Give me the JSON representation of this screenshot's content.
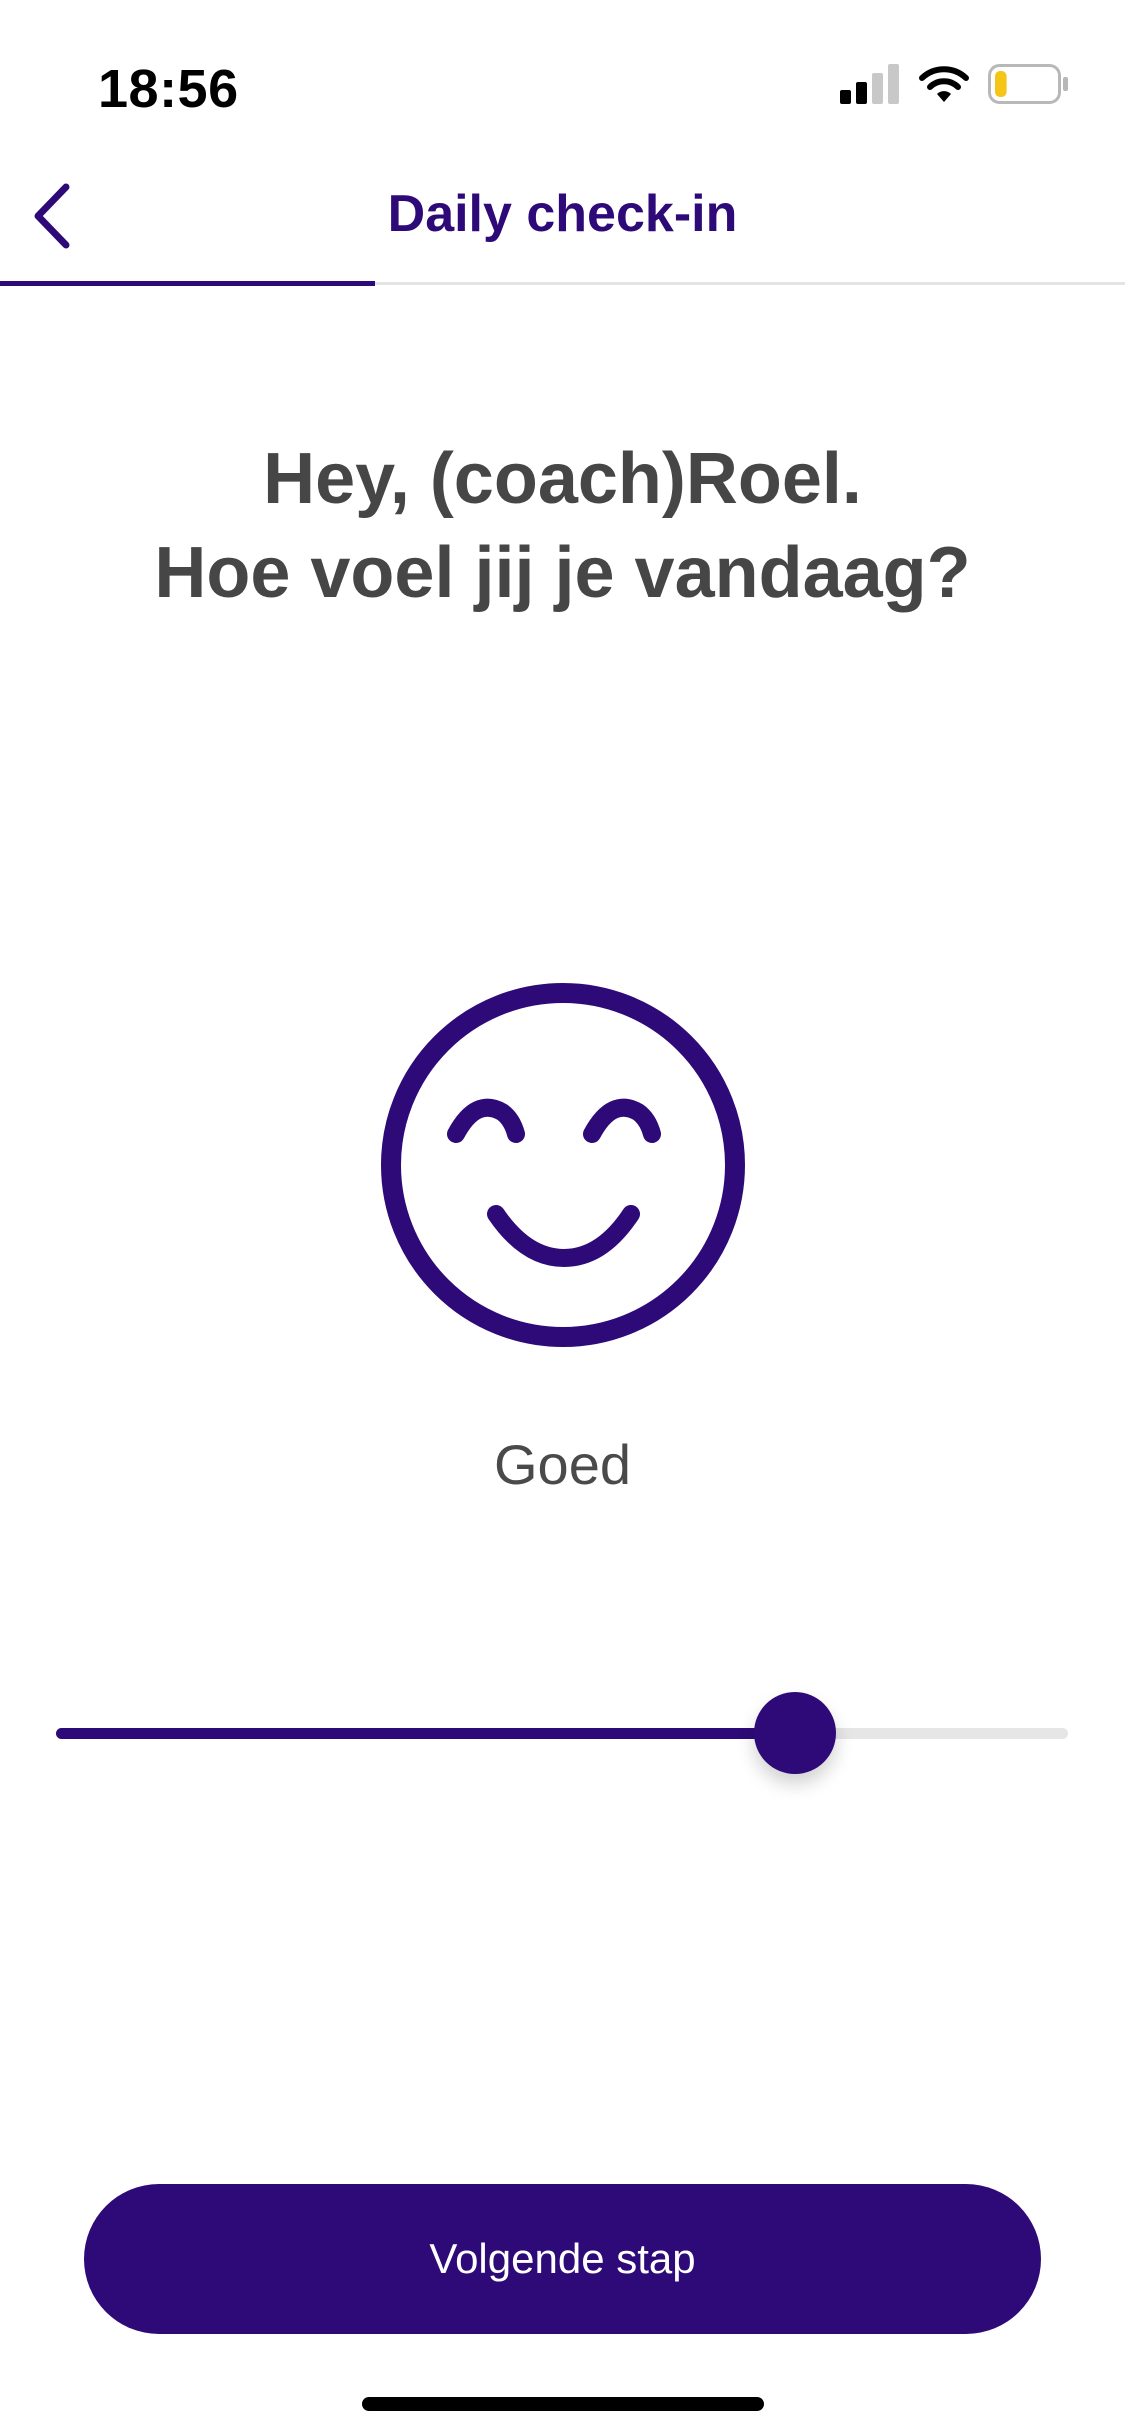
{
  "status_bar": {
    "time": "18:56",
    "signal_icon": "cellular-signal-icon",
    "wifi_icon": "wifi-icon",
    "battery_icon": "battery-icon",
    "battery_level": 0.2,
    "battery_color": "#f5c518"
  },
  "header": {
    "back_icon": "chevron-left-icon",
    "title": "Daily check-in",
    "progress": 0.333
  },
  "question": {
    "line1": "Hey, (coach)Roel.",
    "line2": "Hoe voel jij je vandaag?"
  },
  "mood": {
    "icon": "smiley-face-icon",
    "label": "Goed",
    "slider_value": 0.73
  },
  "actions": {
    "next_label": "Volgende stap"
  },
  "colors": {
    "brand": "#2d0a78",
    "text": "#464646",
    "track": "#e6e6e6"
  }
}
